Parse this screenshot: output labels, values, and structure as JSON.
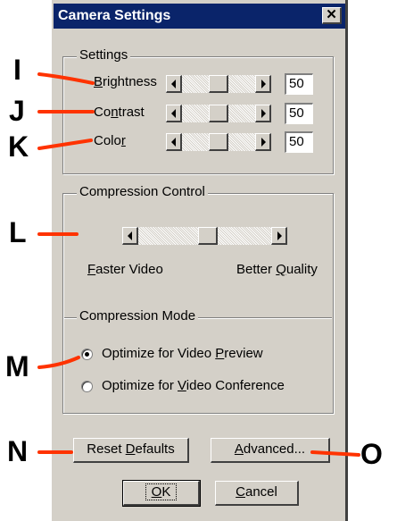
{
  "dialog": {
    "title": "Camera Settings",
    "close_glyph": "✕"
  },
  "settings": {
    "group_label": "Settings",
    "rows": [
      {
        "label_first": "B",
        "label_rest": "rightness",
        "value": "50"
      },
      {
        "label_pre": "Co",
        "label_mn": "n",
        "label_post": "trast",
        "value": "50"
      },
      {
        "label_pre": "Colo",
        "label_mn": "r",
        "label_post": "",
        "value": "50"
      }
    ]
  },
  "compression_control": {
    "group_label": "Compression Control",
    "faster_first": "F",
    "faster_rest": "aster Video",
    "better_pre": "Better ",
    "better_mn": "Q",
    "better_post": "uality"
  },
  "compression_mode": {
    "label": "Compression Mode",
    "options": [
      {
        "pre": "Optimize for Video ",
        "mn": "P",
        "post": "review",
        "selected": true
      },
      {
        "pre": "Optimize for ",
        "mn": "V",
        "post": "ideo Conference",
        "selected": false
      }
    ]
  },
  "buttons": {
    "reset_pre": "Reset ",
    "reset_mn": "D",
    "reset_post": "efaults",
    "advanced_mn": "A",
    "advanced_post": "dvanced...",
    "ok_mn": "O",
    "ok_post": "K",
    "cancel_mn": "C",
    "cancel_post": "ancel"
  },
  "callouts": [
    "I",
    "J",
    "K",
    "L",
    "M",
    "N",
    "O"
  ],
  "colors": {
    "callout_line": "#ff3300",
    "titlebar": "#0a246a",
    "face": "#d4d0c8"
  }
}
